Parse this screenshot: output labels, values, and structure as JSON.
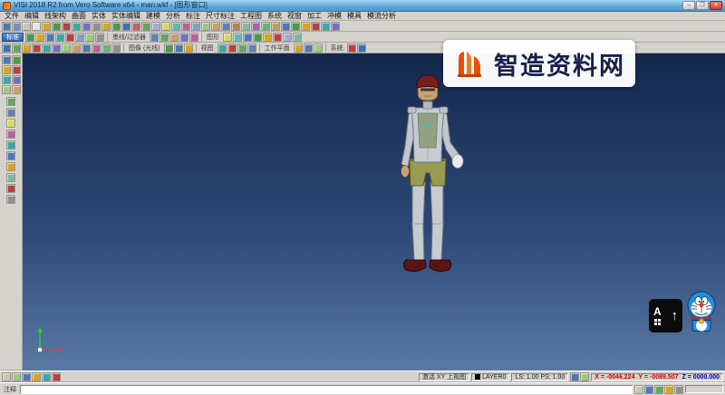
{
  "window": {
    "title": "VISI 2018 R2 from Vero Software x64 - man.wkf - [图形窗口]",
    "minimize_glyph": "–",
    "maximize_glyph": "❐",
    "close_glyph": "✕"
  },
  "menu": {
    "items": [
      "文件",
      "编辑",
      "线架构",
      "曲面",
      "实体",
      "实体编辑",
      "建模",
      "分析",
      "标注",
      "尺寸标注",
      "工程图",
      "系统",
      "视窗",
      "加工",
      "冲模",
      "模具",
      "模流分析"
    ]
  },
  "toolbars": {
    "tab_standard": "标准",
    "label_filter": "墨线/过滤器",
    "label_graphics": "图形",
    "label_image": "图像 (光线)",
    "label_view": "视图",
    "label_workplane": "工作平面",
    "label_system": "系统",
    "row1": [
      "#4a79b8",
      "#6b94c4",
      "#c9c5bd",
      "#e8e5de",
      "#d9a520",
      "#4a9a4a",
      "#b84040",
      "#3aa8a8",
      "#7070c8",
      "#909090",
      "#d9a520",
      "#4a9a4a",
      "#3a72b8",
      "#c06060",
      "#60a860",
      "#a8a8d8",
      "#d8d860",
      "#60b8b8",
      "#b860a0",
      "#80a0c8",
      "#a0c880",
      "#c8a060",
      "#6080b8",
      "#b88060",
      "#80b8a0",
      "#a060b8",
      "#60b880",
      "#b8a060",
      "#4a79b8",
      "#4a9a4a",
      "#d9a520",
      "#b84040",
      "#3aa8a8",
      "#7070c8"
    ],
    "row2a": [
      "#4a9a4a",
      "#d9a520",
      "#4a79b8",
      "#3aa8a8",
      "#b84040",
      "#80a0c8",
      "#a0c880",
      "#909090"
    ],
    "row2b": [
      "#6080b8",
      "#60a860",
      "#c8a060",
      "#7070c8",
      "#b860a0"
    ],
    "row2c": [
      "#d8d860",
      "#60b8b8",
      "#4a79b8",
      "#4a9a4a",
      "#d9a520",
      "#b84040",
      "#a8a8d8",
      "#80b8a0"
    ],
    "row3a": [
      "#3a72b8",
      "#60a860",
      "#d9a520",
      "#b84040",
      "#3aa8a8",
      "#7070c8",
      "#a0c880",
      "#c8a060",
      "#4a79b8",
      "#b860a0",
      "#60b880",
      "#909090"
    ],
    "row3b": [
      "#4a9a4a",
      "#4a79b8",
      "#d9a520"
    ],
    "row3c": [
      "#3aa8a8",
      "#b84040",
      "#60a860",
      "#6080b8"
    ],
    "row3d": [
      "#d9a520",
      "#4a79b8",
      "#a0c880"
    ],
    "row3e": [
      "#b84040",
      "#3a72b8"
    ],
    "left_top": [
      "#4a79b8",
      "#4a9a4a",
      "#d9a520",
      "#b84040",
      "#3aa8a8",
      "#7070c8",
      "#a0c880",
      "#c8a060"
    ],
    "left_col": [
      "#60a860",
      "#6080b8",
      "#d8d860",
      "#b860a0",
      "#3aa8a8",
      "#4a79b8",
      "#d9a520",
      "#80b8a0",
      "#b84040",
      "#909090"
    ]
  },
  "viewport": {
    "background_top": "#14274d",
    "background_mid": "#2c4876",
    "background_bottom": "#5a79a4"
  },
  "model": {
    "cap_color": "#7a1c1c",
    "skin_color": "#c9a273",
    "body_color": "#c6cbd1",
    "chest_color": "#93a083",
    "shorts_color": "#9a9a50",
    "shoe_color": "#5a1414"
  },
  "watermark": {
    "text": "智造资料网",
    "accent": "#e8500a"
  },
  "stickers": {
    "hotkey_letter": "A",
    "hotkey_arrow": "↑"
  },
  "statusbar": {
    "active_view": "激活 XY 上视图",
    "layer": "LAYER0",
    "scale": "LS: 1.00 PS: 1.00",
    "coord_x": "X = -0046.224",
    "coord_y": "Y = -0089.507",
    "coord_z": "Z = 0000.000",
    "note_label": "注释",
    "left_icons": [
      "#c9c5bd",
      "#a0c880",
      "#4a79b8",
      "#d9a520",
      "#3aa8a8",
      "#b84040"
    ],
    "mid_icons": [
      "#4a79b8",
      "#a0c880"
    ],
    "b_icons": [
      "#c9c5bd",
      "#4a79b8",
      "#60a860",
      "#d9a520",
      "#909090"
    ]
  }
}
